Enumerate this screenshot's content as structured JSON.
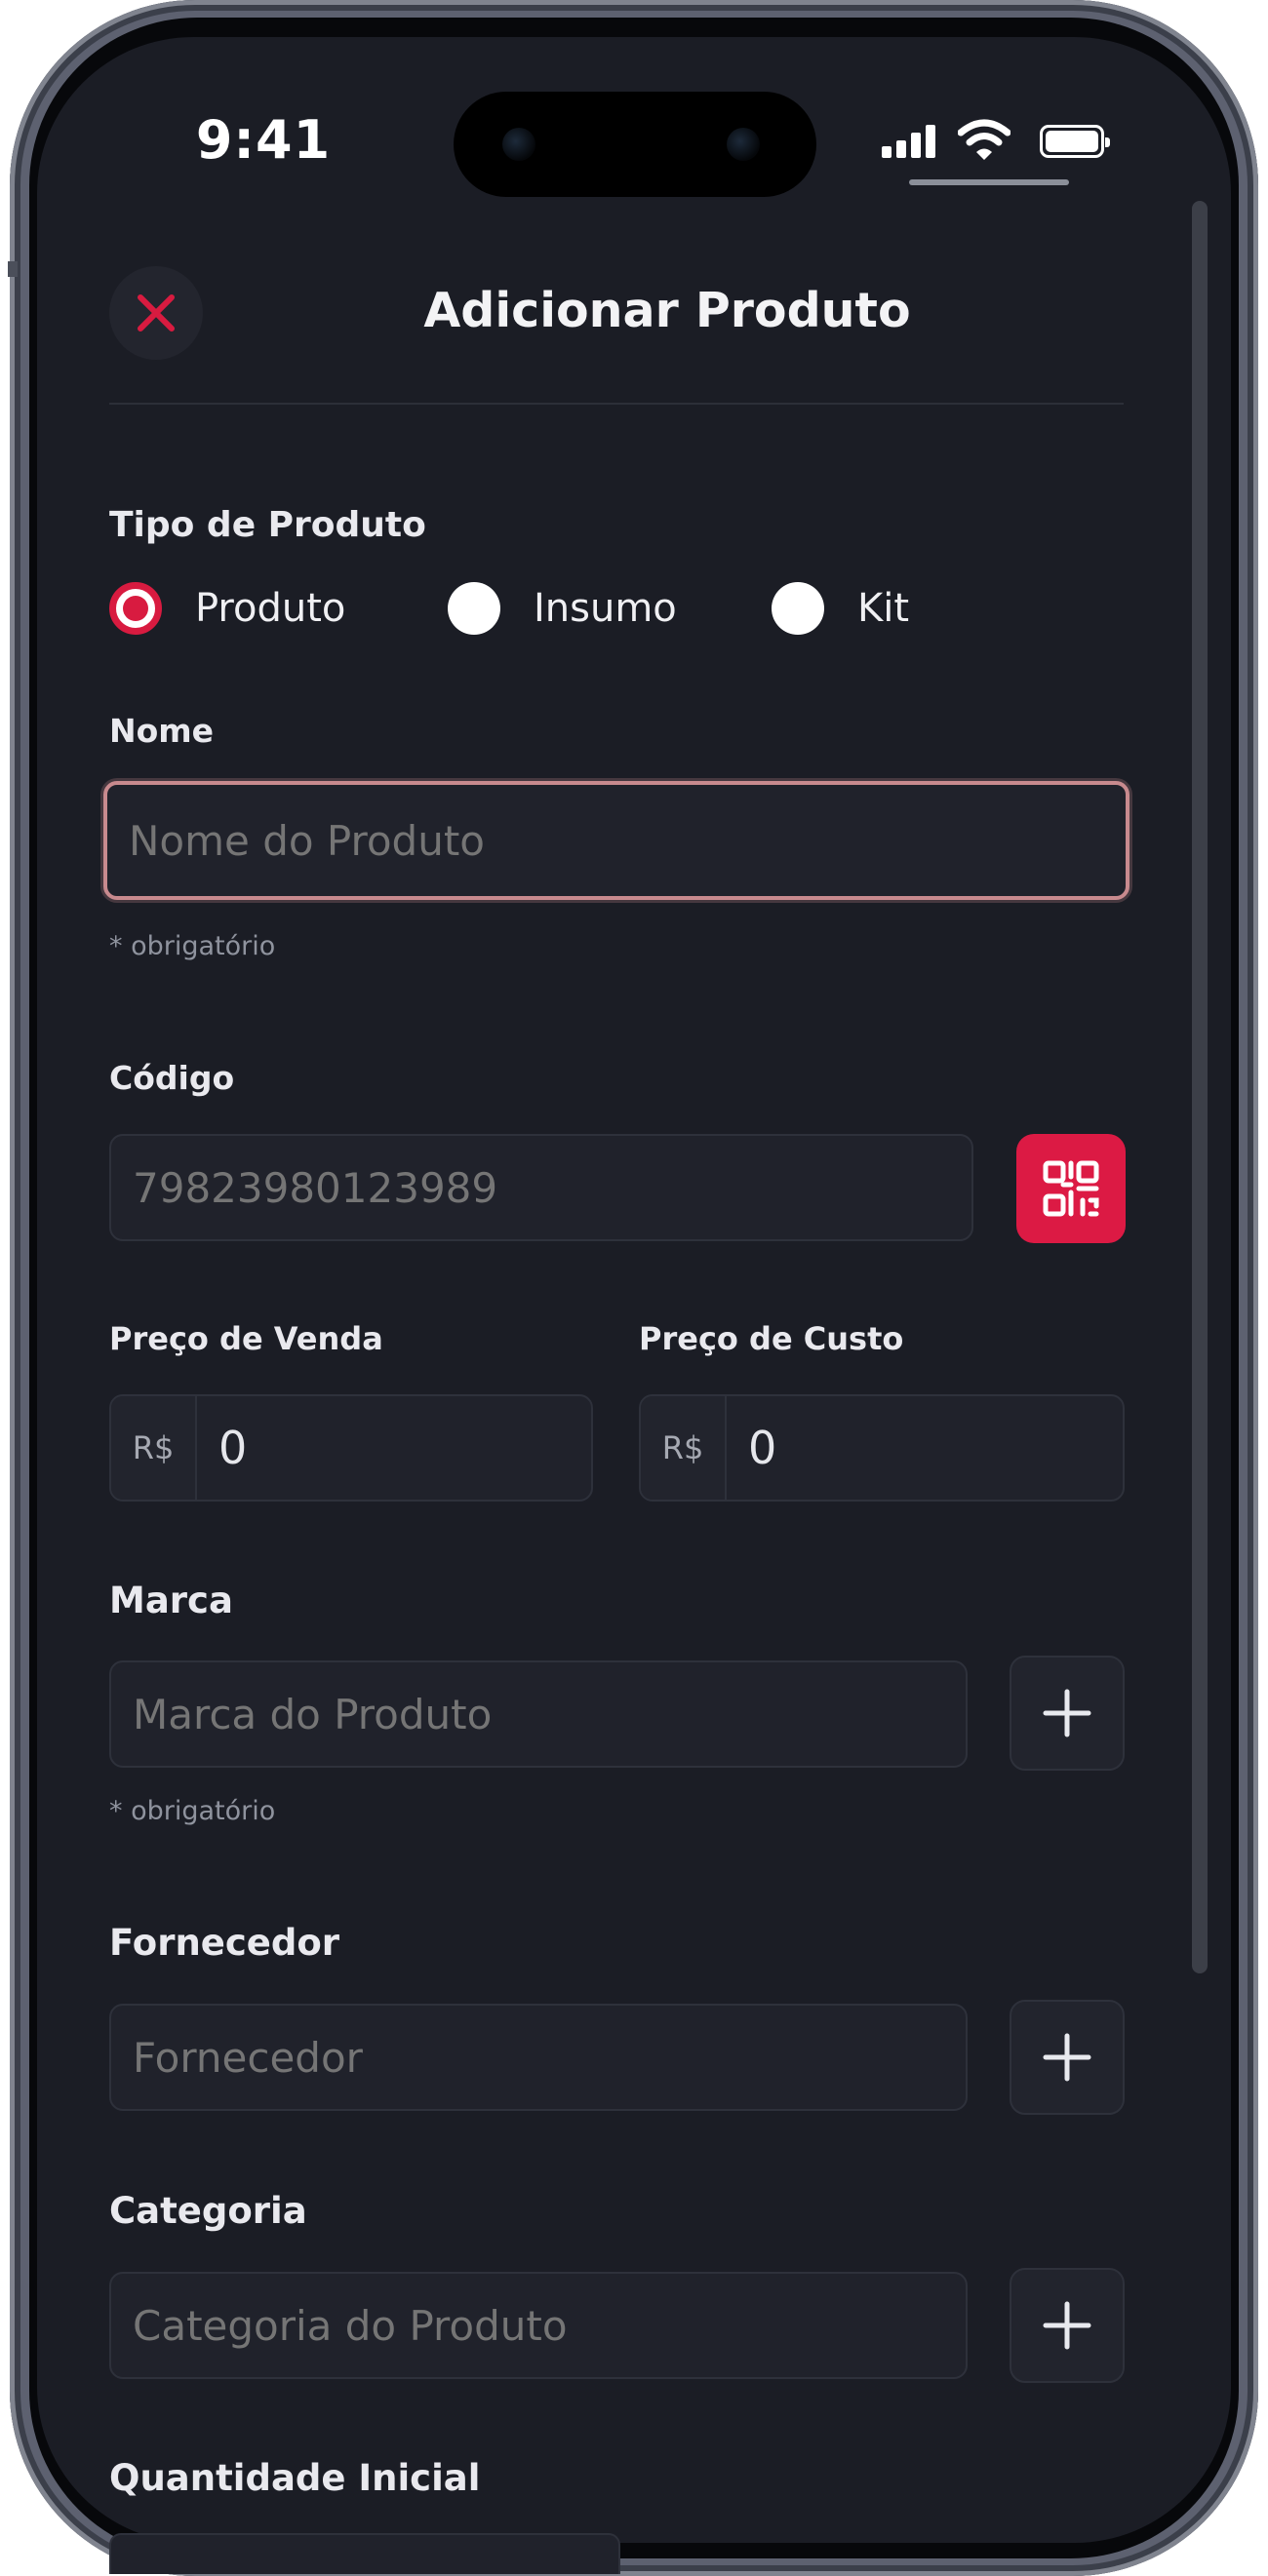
{
  "status_bar": {
    "time": "9:41"
  },
  "header": {
    "title": "Adicionar Produto",
    "close_icon": "close-icon",
    "accent": "#d81b40"
  },
  "product_type": {
    "label": "Tipo de Produto",
    "options": [
      {
        "label": "Produto",
        "checked": true
      },
      {
        "label": "Insumo",
        "checked": false
      },
      {
        "label": "Kit",
        "checked": false
      }
    ]
  },
  "name": {
    "label": "Nome",
    "placeholder": "Nome do Produto",
    "hint": "* obrigatório"
  },
  "code": {
    "label": "Código",
    "placeholder": "79823980123989",
    "scan_icon": "qr-code-icon"
  },
  "sale_price": {
    "label": "Preço de Venda",
    "currency": "R$",
    "value": "0"
  },
  "cost_price": {
    "label": "Preço de Custo",
    "currency": "R$",
    "value": "0"
  },
  "brand": {
    "label": "Marca",
    "placeholder": "Marca do Produto",
    "hint": "* obrigatório"
  },
  "supplier": {
    "label": "Fornecedor",
    "placeholder": "Fornecedor"
  },
  "category": {
    "label": "Categoria",
    "placeholder": "Categoria do Produto"
  },
  "initial_quantity": {
    "label": "Quantidade Inicial"
  }
}
